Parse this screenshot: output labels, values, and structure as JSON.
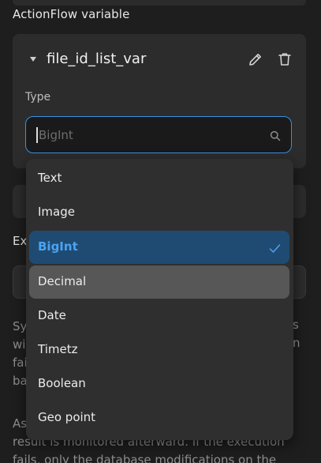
{
  "section": {
    "title": "ActionFlow variable"
  },
  "variable": {
    "name": "file_id_list_var",
    "type_label": "Type"
  },
  "search": {
    "placeholder": "BigInt",
    "value": ""
  },
  "dropdown": {
    "options": [
      {
        "label": "Text"
      },
      {
        "label": "Image"
      },
      {
        "label": "BigInt"
      },
      {
        "label": "Decimal"
      },
      {
        "label": "Date"
      },
      {
        "label": "Timetz"
      },
      {
        "label": "Boolean"
      },
      {
        "label": "Geo point"
      }
    ],
    "selected": "BigInt",
    "hovered": "Decimal"
  },
  "background": {
    "ex_fragment": "Ex",
    "para1_lines": [
      "Sy",
      "wi",
      "fai",
      "ba"
    ],
    "para1_right": [
      "s",
      "n"
    ],
    "para2_lines": [
      "As",
      "result is monitored afterward. If the execution",
      "fails, only the database modifications on the"
    ]
  },
  "colors": {
    "accent": "#3a8fe0",
    "selected_bg": "#1f4b72",
    "selected_text": "#4aa3f2",
    "hover_bg": "#575757",
    "page_bg": "#1e1e1e",
    "card_bg": "#2c2c2c"
  }
}
